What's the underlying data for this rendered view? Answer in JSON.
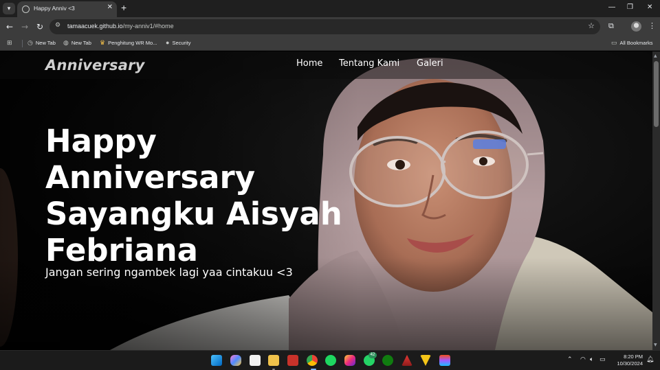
{
  "browser": {
    "tab": {
      "title": "Happy Anniv <3",
      "close": "✕"
    },
    "new_tab": "+",
    "window_controls": {
      "minimize": "—",
      "restore": "❐",
      "close": "✕"
    },
    "url_domain": "tamaacuek.github.io",
    "url_path": "/my-anniv1/#home",
    "bookmarks": [
      {
        "label": "New Tab",
        "icon": "history-icon"
      },
      {
        "label": "New Tab",
        "icon": "globe-icon"
      },
      {
        "label": "Penghitung WR Mo...",
        "icon": "crown-icon"
      },
      {
        "label": "Security",
        "icon": "github-icon"
      }
    ],
    "all_bookmarks": "All Bookmarks"
  },
  "site": {
    "brand": "Anniversary",
    "nav": [
      "Home",
      "Tentang Kami",
      "Galeri"
    ],
    "hero_title": "Happy Anniversary Sayangku Aisyah Febriana",
    "hero_subtitle": "Jangan sering ngambek lagi yaa cintakuu <3"
  },
  "taskbar": {
    "apps": [
      "windows-start",
      "copilot",
      "store",
      "file-explorer",
      "app-red",
      "chrome",
      "spotify",
      "instagram",
      "whatsapp",
      "xbox",
      "app-a",
      "app-v",
      "figma"
    ],
    "whatsapp_badge": "42",
    "time": "8:20 PM",
    "date": "10/30/2024"
  },
  "colors": {
    "tab_active": "#3c3c3c",
    "toolbar": "#3c3c3c",
    "tabstrip": "#1f1f1f",
    "hijab": "#b49a9c"
  }
}
